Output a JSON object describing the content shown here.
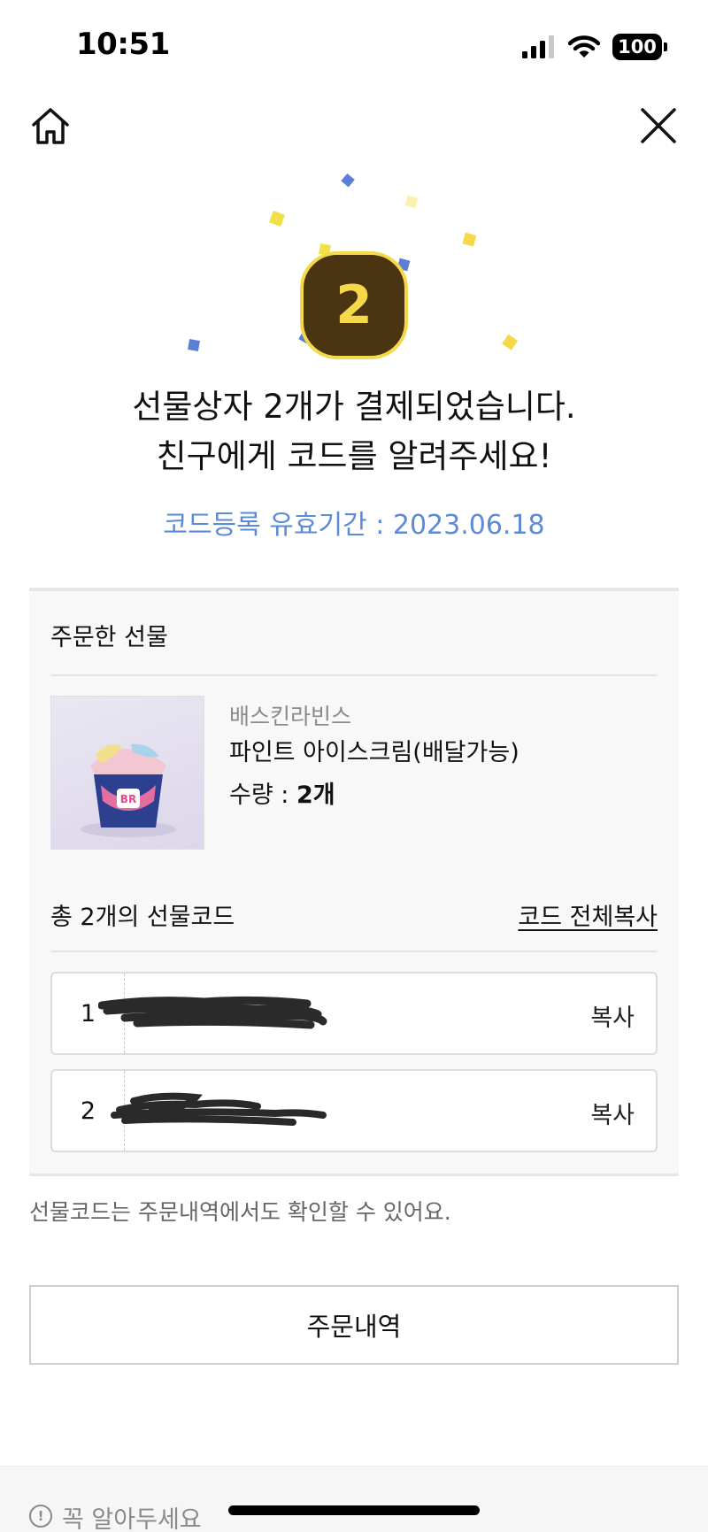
{
  "status_bar": {
    "time": "10:51",
    "battery": "100"
  },
  "nav": {
    "home_icon": "home-icon",
    "close_icon": "close-icon"
  },
  "badge": {
    "count": "2",
    "bg_color": "#4a3411",
    "accent_color": "#f5d94a"
  },
  "headline": {
    "line1": "선물상자 2개가 결제되었습니다.",
    "line2": "친구에게 코드를 알려주세요!"
  },
  "validity": {
    "text": "코드등록 유효기간 : 2023.06.18",
    "color": "#5b8ad6"
  },
  "order": {
    "section_title": "주문한 선물",
    "brand": "배스킨라빈스",
    "product_name": "파인트 아이스크림(배달가능)",
    "quantity_label": "수량 : ",
    "quantity_value": "2개"
  },
  "codes": {
    "title": "총 2개의 선물코드",
    "copy_all_label": "코드 전체복사",
    "items": [
      {
        "index": "1",
        "copy_label": "복사"
      },
      {
        "index": "2",
        "copy_label": "복사"
      }
    ]
  },
  "note": "선물코드는 주문내역에서도 확인할 수 있어요.",
  "orders_button": "주문내역",
  "footer": {
    "info_label": "꼭 알아두세요"
  }
}
